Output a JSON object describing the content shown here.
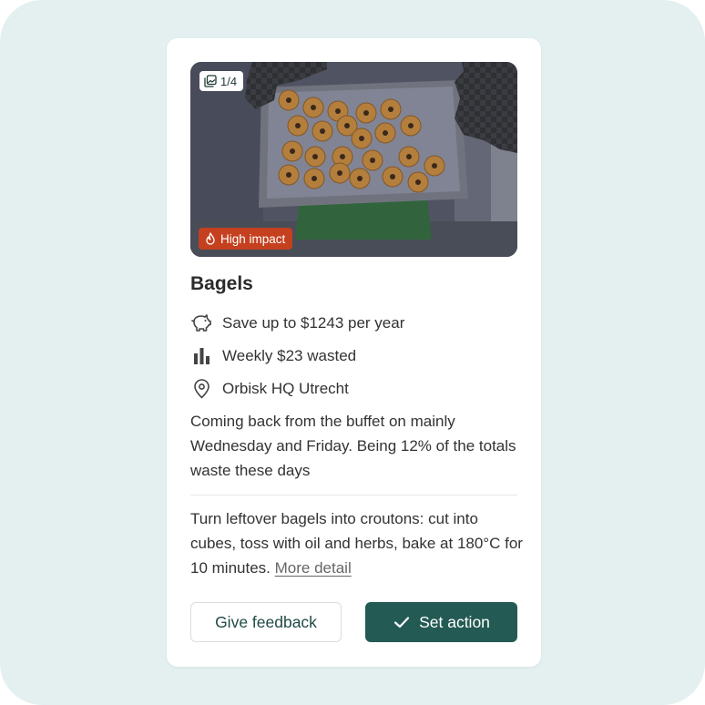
{
  "card": {
    "photo": {
      "counter": "1/4",
      "counter_icon": "gallery-icon",
      "badge": "High impact",
      "badge_icon": "flame-icon",
      "badge_color": "#c4401f"
    },
    "title": "Bagels",
    "meta": [
      {
        "icon": "piggy-bank-icon",
        "text": "Save up to $1243 per year"
      },
      {
        "icon": "bar-chart-icon",
        "text": "Weekly $23 wasted"
      },
      {
        "icon": "location-pin-icon",
        "text": "Orbisk HQ Utrecht"
      }
    ],
    "description": "Coming back from the buffet on mainly Wednesday and Friday. Being 12% of the totals waste these days",
    "tip": "Turn leftover bagels into croutons: cut into cubes, toss with oil and herbs, bake at 180°C for 10 minutes.",
    "more_link": "More detail",
    "buttons": {
      "feedback": "Give feedback",
      "set_action": "Set action",
      "set_action_icon": "check-icon"
    }
  },
  "colors": {
    "background": "#e4f0f0",
    "primary": "#235a53",
    "danger": "#c4401f"
  }
}
